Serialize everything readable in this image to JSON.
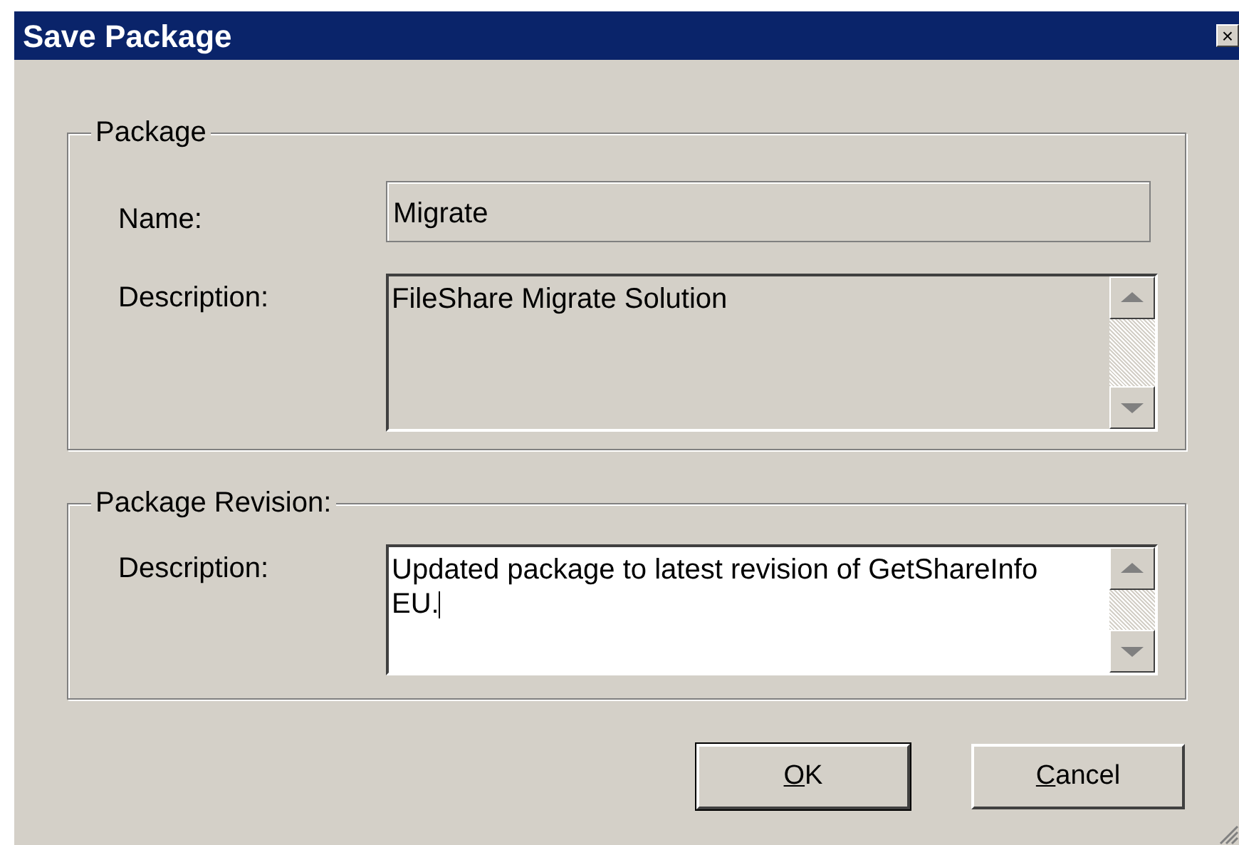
{
  "window": {
    "title": "Save Package",
    "close_glyph": "×"
  },
  "package": {
    "legend": "Package",
    "name": {
      "label": "Name:",
      "value": "Migrate",
      "disabled": true
    },
    "description": {
      "label": "Description:",
      "value": "FileShare Migrate Solution",
      "disabled": true,
      "focused": false
    }
  },
  "revision": {
    "legend": "Package Revision:",
    "description": {
      "label": "Description:",
      "value": "Updated package to latest revision of GetShareInfo EU.",
      "disabled": false,
      "focused": true
    }
  },
  "buttons": [
    {
      "label": "OK",
      "first_letter_underlined": true,
      "default": true
    },
    {
      "label": "Cancel",
      "first_letter_underlined": true,
      "default": false
    }
  ]
}
